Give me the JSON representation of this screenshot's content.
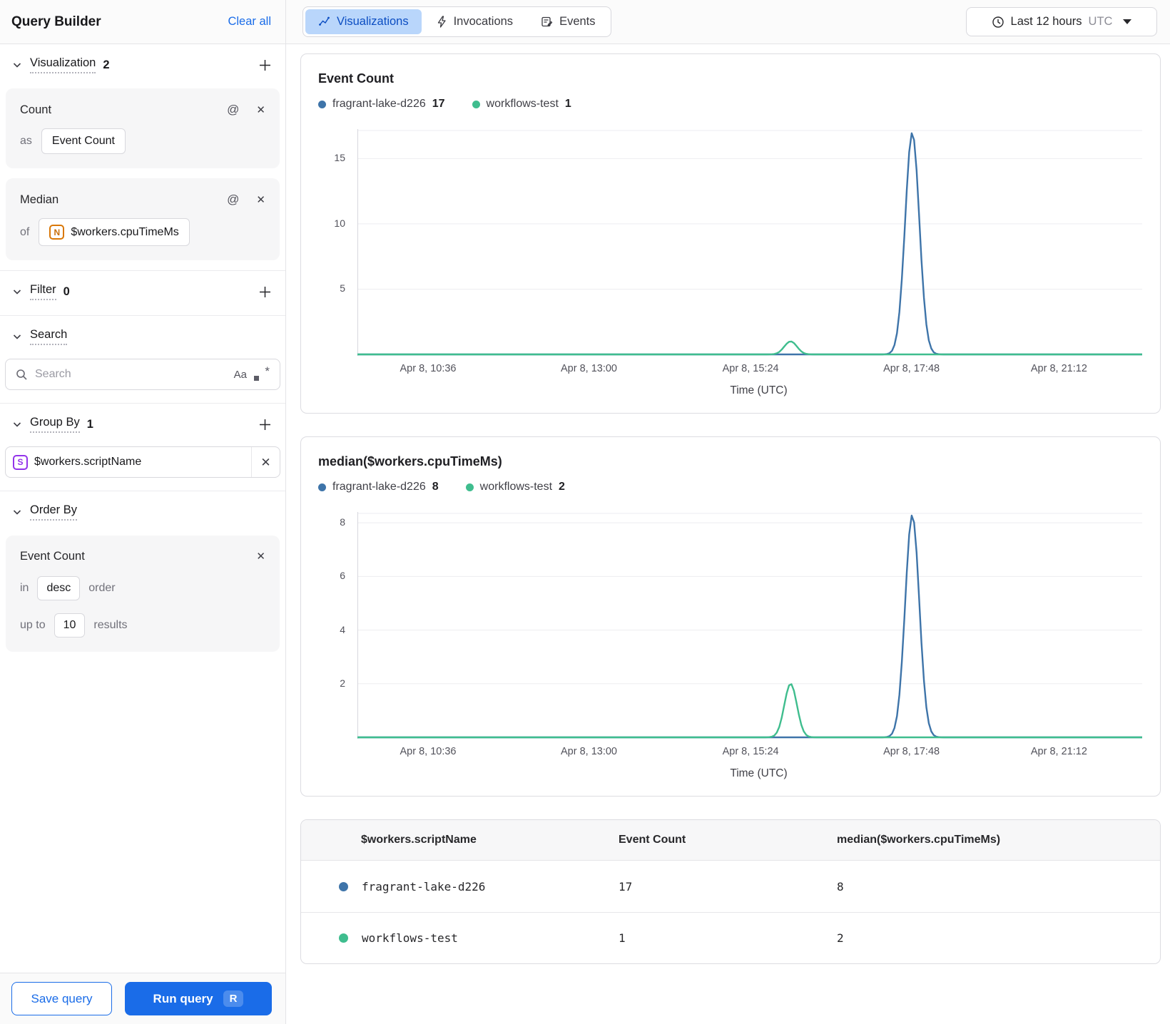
{
  "colors": {
    "accent_blue": "#1A6CE8",
    "active_tab_bg": "#B9D6FB",
    "active_tab_text": "#0B4DC2",
    "series": [
      "#3E74A9",
      "#3FBD8E"
    ],
    "number_type_orange": "#D97706",
    "string_type_purple": "#9333EA"
  },
  "sidebar": {
    "title": "Query Builder",
    "clear_all_label": "Clear all",
    "sections": {
      "visualization": {
        "label": "Visualization",
        "count": "2"
      },
      "filter": {
        "label": "Filter",
        "count": "0"
      },
      "search": {
        "label": "Search"
      },
      "group_by": {
        "label": "Group By",
        "count": "1"
      },
      "order_by": {
        "label": "Order By"
      }
    },
    "visualization_cards": [
      {
        "title": "Count",
        "prefix": "as",
        "value": "Event Count"
      },
      {
        "title": "Median",
        "prefix": "of",
        "type_icon": "N",
        "value": "$workers.cpuTimeMs"
      }
    ],
    "search_input": {
      "placeholder": "Search",
      "match_case_label": "Aa"
    },
    "group_by_chips": [
      {
        "type_icon": "S",
        "value": "$workers.scriptName"
      }
    ],
    "order_by_card": {
      "title": "Event Count",
      "in_label": "in",
      "direction": "desc",
      "order_label": "order",
      "up_to_label": "up to",
      "limit": "10",
      "results_label": "results"
    },
    "footer": {
      "save_label": "Save query",
      "run_label": "Run query",
      "run_shortcut": "R"
    }
  },
  "topbar": {
    "tabs": [
      {
        "label": "Visualizations",
        "active": true
      },
      {
        "label": "Invocations",
        "active": false
      },
      {
        "label": "Events",
        "active": false
      }
    ],
    "time_range": {
      "label": "Last 12 hours",
      "timezone": "UTC"
    }
  },
  "chart_data": [
    {
      "type": "line",
      "title": "Event Count",
      "xlabel": "Time (UTC)",
      "x_tick_labels": [
        "Apr 8, 10:36",
        "Apr 8, 13:00",
        "Apr 8, 15:24",
        "Apr 8, 17:48",
        "Apr 8, 21:12"
      ],
      "x_tick_fractions": [
        0.09,
        0.295,
        0.501,
        0.706,
        0.894
      ],
      "y_ticks": [
        5,
        10,
        15
      ],
      "ylim": [
        0,
        17.15
      ],
      "grid": true,
      "legend_position": "top",
      "legend": [
        {
          "name": "fragrant-lake-d226",
          "value": "17"
        },
        {
          "name": "workflows-test",
          "value": "1"
        }
      ],
      "series": [
        {
          "name": "fragrant-lake-d226",
          "color": "#3E74A9",
          "baseline": 0,
          "peak": {
            "x_fraction": 0.707,
            "value": 17,
            "sigma": 0.009
          }
        },
        {
          "name": "workflows-test",
          "color": "#3FBD8E",
          "baseline": 0,
          "peak": {
            "x_fraction": 0.552,
            "value": 1,
            "sigma": 0.008
          }
        }
      ]
    },
    {
      "type": "line",
      "title": "median($workers.cpuTimeMs)",
      "xlabel": "Time (UTC)",
      "x_tick_labels": [
        "Apr 8, 10:36",
        "Apr 8, 13:00",
        "Apr 8, 15:24",
        "Apr 8, 17:48",
        "Apr 8, 21:12"
      ],
      "x_tick_fractions": [
        0.09,
        0.295,
        0.501,
        0.706,
        0.894
      ],
      "y_ticks": [
        2,
        4,
        6,
        8
      ],
      "ylim": [
        0,
        8.35
      ],
      "grid": true,
      "legend_position": "top",
      "legend": [
        {
          "name": "fragrant-lake-d226",
          "value": "8"
        },
        {
          "name": "workflows-test",
          "value": "2"
        }
      ],
      "series": [
        {
          "name": "fragrant-lake-d226",
          "color": "#3E74A9",
          "baseline": 0,
          "peak": {
            "x_fraction": 0.707,
            "value": 8.3,
            "sigma": 0.009
          }
        },
        {
          "name": "workflows-test",
          "color": "#3FBD8E",
          "baseline": 0,
          "peak": {
            "x_fraction": 0.552,
            "value": 2,
            "sigma": 0.008
          }
        }
      ]
    }
  ],
  "table": {
    "columns": [
      "$workers.scriptName",
      "Event Count",
      "median($workers.cpuTimeMs)"
    ],
    "rows": [
      {
        "name": "fragrant-lake-d226",
        "event_count": "17",
        "median": "8",
        "series_index": 0
      },
      {
        "name": "workflows-test",
        "event_count": "1",
        "median": "2",
        "series_index": 1
      }
    ]
  }
}
